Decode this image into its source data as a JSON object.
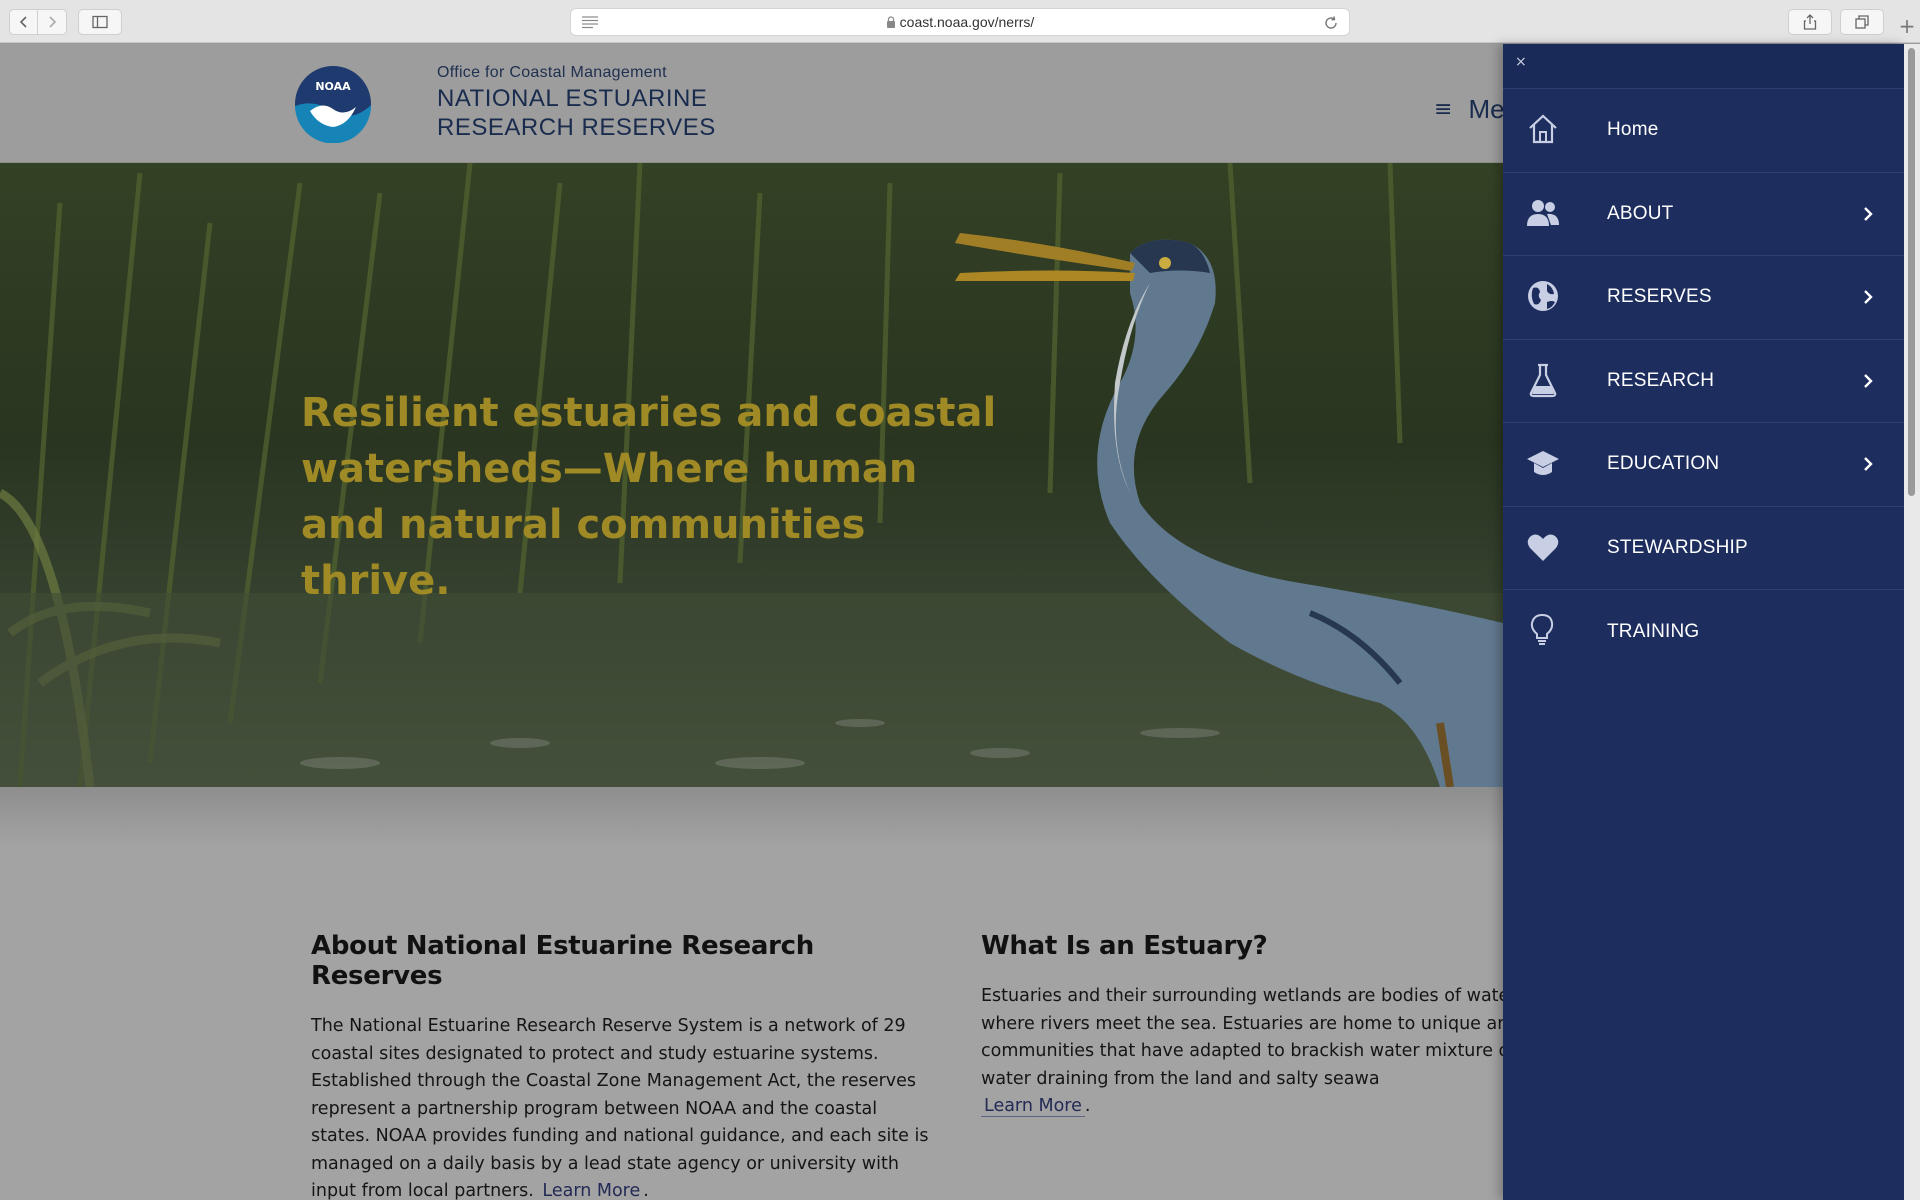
{
  "browser": {
    "url": "coast.noaa.gov/nerrs/"
  },
  "header": {
    "logo_text": "NOAA",
    "org_subtitle": "Office for Coastal Management",
    "org_title_line1": "NATIONAL ESTUARINE",
    "org_title_line2": "RESEARCH RESERVES",
    "menu_label": "Menu"
  },
  "hero": {
    "headline": "Resilient estuaries and coastal watersheds—Where human and natural communities thrive."
  },
  "about": {
    "heading": "About National Estuarine Research Reserves",
    "body": "The National Estuarine Research Reserve System is a network of 29 coastal sites designated to protect and study estuarine systems. Established through the Coastal Zone Management Act, the reserves represent a partnership program between NOAA and the coastal states. NOAA provides funding and national guidance, and each site is managed on a daily basis by a lead state agency or university with input from local partners.",
    "link": "Learn More",
    "suffix": "."
  },
  "estuary": {
    "heading": "What Is an Estuary?",
    "body": "Estuaries and their surrounding wetlands are bodies of water found where rivers meet the sea. Estuaries are home to unique and animal communities that have adapted to brackish water mixture of fresh water draining from the land and salty seawa",
    "link": "Learn More",
    "suffix": "."
  },
  "drawer": {
    "close": "×",
    "items": [
      {
        "label": "Home",
        "icon": "home-icon",
        "has_submenu": false
      },
      {
        "label": "ABOUT",
        "icon": "people-icon",
        "has_submenu": true
      },
      {
        "label": "RESERVES",
        "icon": "globe-icon",
        "has_submenu": true
      },
      {
        "label": "RESEARCH",
        "icon": "flask-icon",
        "has_submenu": true
      },
      {
        "label": "EDUCATION",
        "icon": "graduation-cap-icon",
        "has_submenu": true
      },
      {
        "label": "STEWARDSHIP",
        "icon": "heart-icon",
        "has_submenu": false
      },
      {
        "label": "TRAINING",
        "icon": "lightbulb-icon",
        "has_submenu": false
      }
    ]
  },
  "colors": {
    "drawer_bg": "#1c2d5e",
    "headline": "#a08a25",
    "navy_text": "#1a2c4e"
  }
}
